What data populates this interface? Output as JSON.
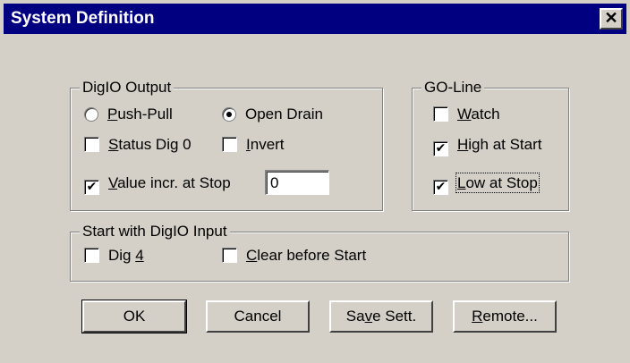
{
  "window": {
    "title": "System Definition",
    "close_glyph": "✕"
  },
  "digio_output": {
    "legend": "DigIO Output",
    "push_pull": {
      "label_pre": "",
      "label_ul": "P",
      "label_post": "ush-Pull",
      "selected": false
    },
    "open_drain": {
      "label": "Open Drain",
      "selected": true
    },
    "status_dig0": {
      "label_ul": "S",
      "label_post": "tatus Dig 0",
      "checked": false
    },
    "invert": {
      "label_ul": "I",
      "label_post": "nvert",
      "checked": false
    },
    "value_incr": {
      "label_ul": "V",
      "label_post": "alue incr. at Stop",
      "checked": true,
      "value": "0"
    }
  },
  "go_line": {
    "legend": "GO-Line",
    "watch": {
      "label_ul": "W",
      "label_post": "atch",
      "checked": false
    },
    "high_at_start": {
      "label_ul": "H",
      "label_post": "igh at Start",
      "checked": true
    },
    "low_at_stop": {
      "label_ul": "L",
      "label_post": "ow at Stop",
      "checked": true
    }
  },
  "start_input": {
    "legend": "Start with DigIO Input",
    "dig4": {
      "label_pre": "Dig ",
      "label_ul": "4",
      "checked": false
    },
    "clear_before_start": {
      "label_ul": "C",
      "label_post": "lear before Start",
      "checked": false
    }
  },
  "buttons": {
    "ok": "OK",
    "cancel": "Cancel",
    "save_pre": "Sa",
    "save_ul": "v",
    "save_post": "e Sett.",
    "remote_ul": "R",
    "remote_post": "emote..."
  },
  "check_glyph": "✔"
}
